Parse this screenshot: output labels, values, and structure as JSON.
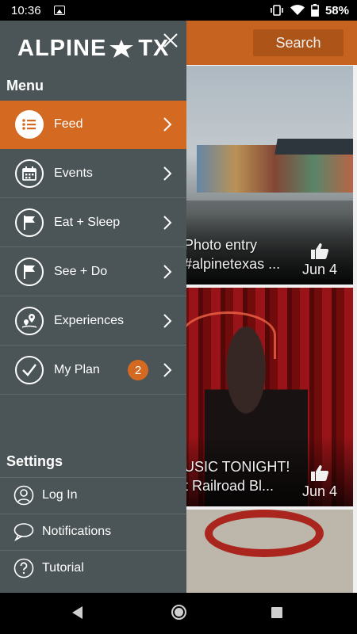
{
  "status_bar": {
    "time": "10:36",
    "battery": "58%"
  },
  "app": {
    "search_label": "Search",
    "feed_cards": [
      {
        "caption_line1": "Photo entry",
        "caption_line2": "#alpinetexas ...",
        "date": "Jun 4"
      },
      {
        "caption_line1": "USIC TONIGHT!",
        "caption_line2": "t Railroad Bl...",
        "date": "Jun 4"
      }
    ]
  },
  "drawer": {
    "logo_left": "ALPINE",
    "logo_right": "TX",
    "menu_title": "Menu",
    "menu_items": [
      {
        "label": "Feed",
        "icon": "list-icon",
        "active": true
      },
      {
        "label": "Events",
        "icon": "calendar-icon"
      },
      {
        "label": "Eat + Sleep",
        "icon": "flag-icon"
      },
      {
        "label": "See + Do",
        "icon": "flag-icon"
      },
      {
        "label": "Experiences",
        "icon": "map-pin-icon"
      },
      {
        "label": "My Plan",
        "icon": "check-icon",
        "badge": "2"
      }
    ],
    "settings_title": "Settings",
    "settings_items": [
      {
        "label": "Log In",
        "icon": "user-icon"
      },
      {
        "label": "Notifications",
        "icon": "chat-bubble-icon"
      },
      {
        "label": "Tutorial",
        "icon": "question-icon"
      }
    ]
  },
  "colors": {
    "accent": "#d46a22",
    "drawer_bg": "#4b5456"
  }
}
